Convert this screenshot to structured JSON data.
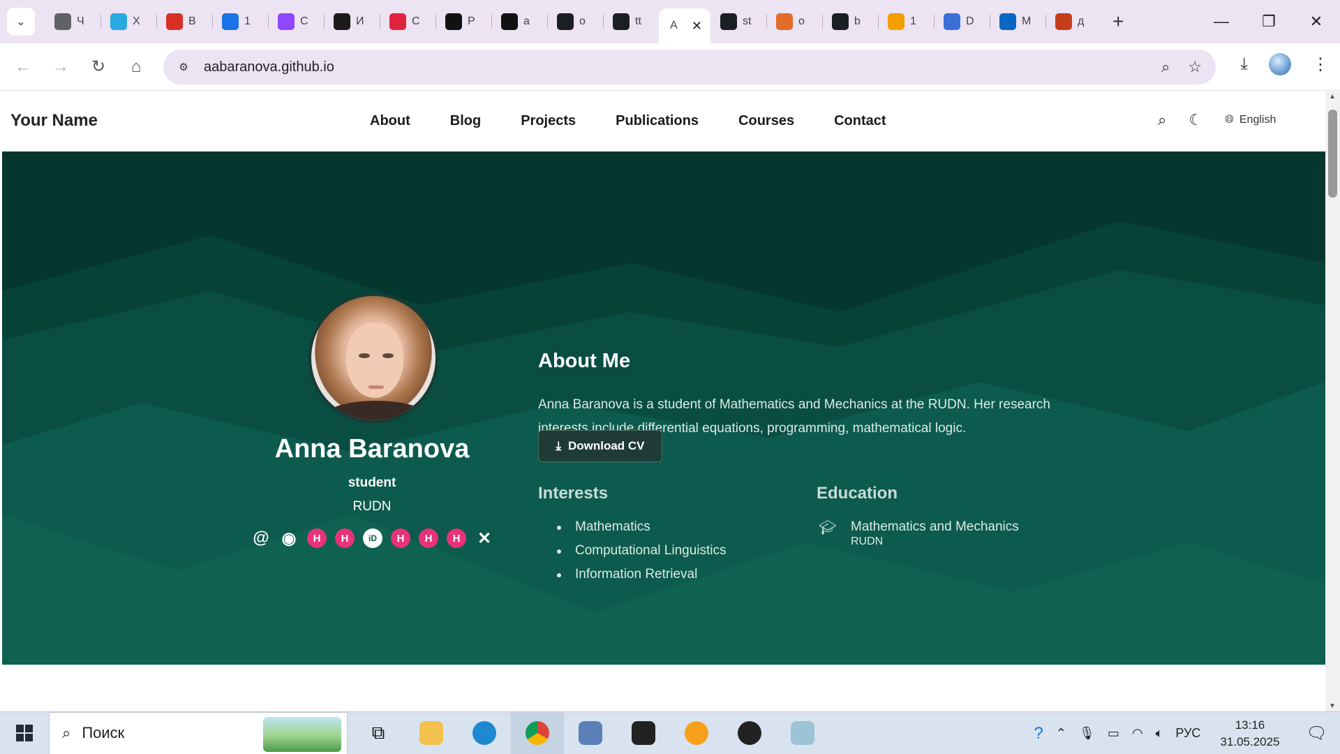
{
  "browser": {
    "tabs": [
      {
        "title": "Ч",
        "icon": "chrome-icon",
        "color": "#5f6368"
      },
      {
        "title": "Х",
        "icon": "cloud-icon",
        "color": "#2aa8e0"
      },
      {
        "title": "В",
        "icon": "gmail-icon",
        "color": "#d93025"
      },
      {
        "title": "1",
        "icon": "number-one-icon",
        "color": "#1a73e8"
      },
      {
        "title": "С",
        "icon": "twitch-icon",
        "color": "#9146ff"
      },
      {
        "title": "И",
        "icon": "r-icon",
        "color": "#1b1b1b"
      },
      {
        "title": "С",
        "icon": "s-icon",
        "color": "#e02440"
      },
      {
        "title": "Р",
        "icon": "p-icon",
        "color": "#111111"
      },
      {
        "title": "a",
        "icon": "n-icon",
        "color": "#111111"
      },
      {
        "title": "o",
        "icon": "github-icon",
        "color": "#1b1f23"
      },
      {
        "title": "tt",
        "icon": "github-copilot-icon",
        "color": "#1b1f23"
      },
      {
        "title": "A",
        "icon": "page-icon",
        "color": "#444444",
        "active": true
      },
      {
        "title": "st",
        "icon": "github-icon",
        "color": "#1b1f23"
      },
      {
        "title": "o",
        "icon": "m-icon",
        "color": "#e36b2c"
      },
      {
        "title": "b",
        "icon": "github-icon",
        "color": "#1b1f23"
      },
      {
        "title": "1",
        "icon": "mail-icon",
        "color": "#f4a000"
      },
      {
        "title": "D",
        "icon": "d-icon",
        "color": "#3a6fd8"
      },
      {
        "title": "M",
        "icon": "onedrive-icon",
        "color": "#0a66c2"
      },
      {
        "title": "д",
        "icon": "powerpoint-icon",
        "color": "#c43e1c"
      }
    ],
    "url": "aabaranova.github.io"
  },
  "site": {
    "brand": "Your Name",
    "nav": [
      "About",
      "Blog",
      "Projects",
      "Publications",
      "Courses",
      "Contact"
    ],
    "language": "English",
    "profile": {
      "name": "Anna Baranova",
      "role": "student",
      "org": "RUDN",
      "socials": [
        {
          "icon": "at-icon",
          "glyph": "@",
          "kind": "plain"
        },
        {
          "icon": "github-icon",
          "glyph": "◉",
          "kind": "plain"
        },
        {
          "icon": "hh-icon",
          "glyph": "H",
          "kind": "hh"
        },
        {
          "icon": "hh-icon",
          "glyph": "H",
          "kind": "hh"
        },
        {
          "icon": "orcid-icon",
          "glyph": "iD",
          "kind": "orcid"
        },
        {
          "icon": "hh-icon",
          "glyph": "H",
          "kind": "hh"
        },
        {
          "icon": "hh-icon",
          "glyph": "H",
          "kind": "hh"
        },
        {
          "icon": "hh-icon",
          "glyph": "H",
          "kind": "hh"
        },
        {
          "icon": "x-icon",
          "glyph": "✕",
          "kind": "plain"
        }
      ]
    },
    "about": {
      "heading": "About Me",
      "text": "Anna Baranova is a student of Mathematics and Mechanics at the RUDN. Her research interests include differential equations, programming, mathematical logic.",
      "cv_label": "Download CV"
    },
    "interests": {
      "heading": "Interests",
      "items": [
        "Mathematics",
        "Computational Linguistics",
        "Information Retrieval"
      ]
    },
    "education": {
      "heading": "Education",
      "degree": "Mathematics and Mechanics",
      "institution": "RUDN"
    }
  },
  "taskbar": {
    "search_placeholder": "Поиск",
    "language": "РУС",
    "time": "13:16",
    "date": "31.05.2025"
  }
}
